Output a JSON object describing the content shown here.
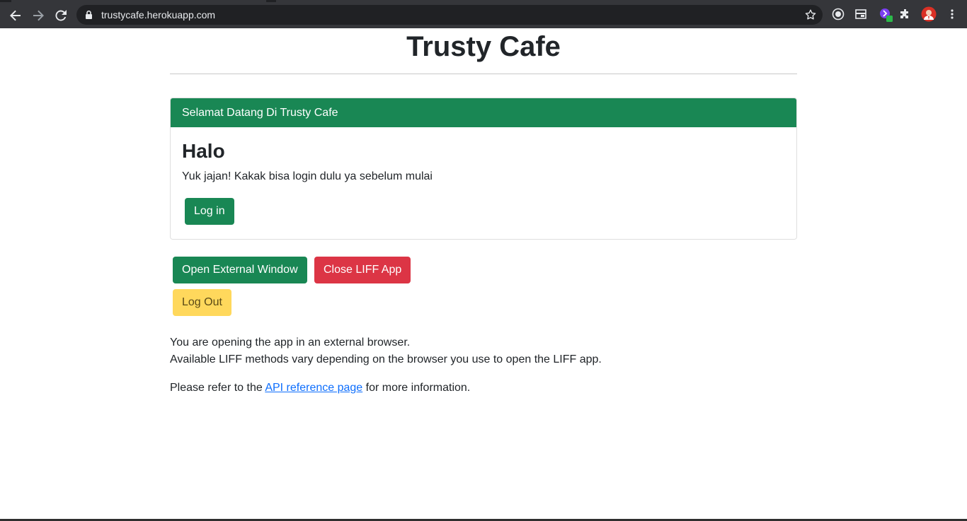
{
  "browser": {
    "url": "trustycafe.herokuapp.com",
    "icons": [
      "back-icon",
      "forward-icon",
      "reload-icon",
      "lock-icon",
      "star-icon",
      "chrome-extension-icon",
      "reading-list-icon",
      "profile-extension-icon",
      "extensions-puzzle-icon",
      "avatar",
      "menu-kebab-icon"
    ]
  },
  "page": {
    "title": "Trusty Cafe",
    "card": {
      "header": "Selamat Datang Di Trusty Cafe",
      "title": "Halo",
      "text": "Yuk jajan! Kakak bisa login dulu ya sebelum mulai",
      "login_label": "Log in"
    },
    "buttons": {
      "open_external": "Open External Window",
      "close_liff": "Close LIFF App",
      "log_out": "Log Out"
    },
    "info_line1": "You are opening the app in an external browser.",
    "info_line2": "Available LIFF methods vary depending on the browser you use to open the LIFF app.",
    "refer_before": "Please refer to the ",
    "refer_link": "API reference page",
    "refer_after": " for more information."
  },
  "colors": {
    "success": "#198754",
    "danger": "#dc3545",
    "warning": "#ffd85c",
    "link": "#0d6efd"
  }
}
